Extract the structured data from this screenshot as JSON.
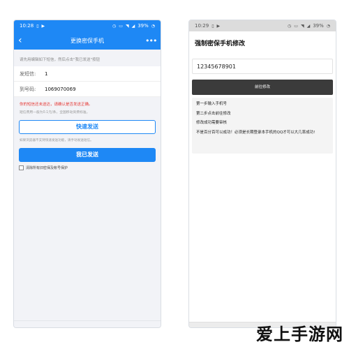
{
  "left": {
    "status": {
      "time": "10:28",
      "battery": "39%",
      "icons": [
        "sim-icon",
        "video-icon",
        "alarm-icon",
        "nfc-icon",
        "wifi-icon",
        "signal-icon"
      ]
    },
    "nav": {
      "back": "‹",
      "title": "更换密保手机",
      "more": "•••"
    },
    "hint_top": "请先用编辑如下短信，然后点击\"我已发送\"按钮",
    "fields": [
      {
        "label": "发短信:",
        "value": "1"
      },
      {
        "label": "到号码:",
        "value": "1069070069"
      }
    ],
    "warn_red": "你的短信还未送达，请确认是否发送正确。",
    "warn_gray": "短信费用一般为0.1元/条，全国移动资费标准。",
    "quick_send": "快速发送",
    "small_hint": "如果浏览器不支持快速发送功能，请手动发送短信。",
    "sent_button": "我已发送",
    "checkbox_label": "清除所有旧密保及帐号保护",
    "colors": {
      "accent": "#1e88f5",
      "warning": "#e53935"
    }
  },
  "right": {
    "status": {
      "time": "10:29",
      "battery": "39%",
      "icons": [
        "sim-icon",
        "video-icon",
        "alarm-icon",
        "nfc-icon",
        "wifi-icon",
        "signal-icon"
      ]
    },
    "heading": "强制密保手机修改",
    "input_value": "12345678901",
    "button": "前往修改",
    "steps": [
      "第一步输入手机号",
      "第二步点击前往修改",
      "修改成功需要审核",
      "不是百分百可以成功！必须是长期登录本手机的QQ才可以大几率成功!"
    ],
    "colors": {
      "button": "#3b3b3b"
    }
  },
  "watermark": "爱上手游网"
}
